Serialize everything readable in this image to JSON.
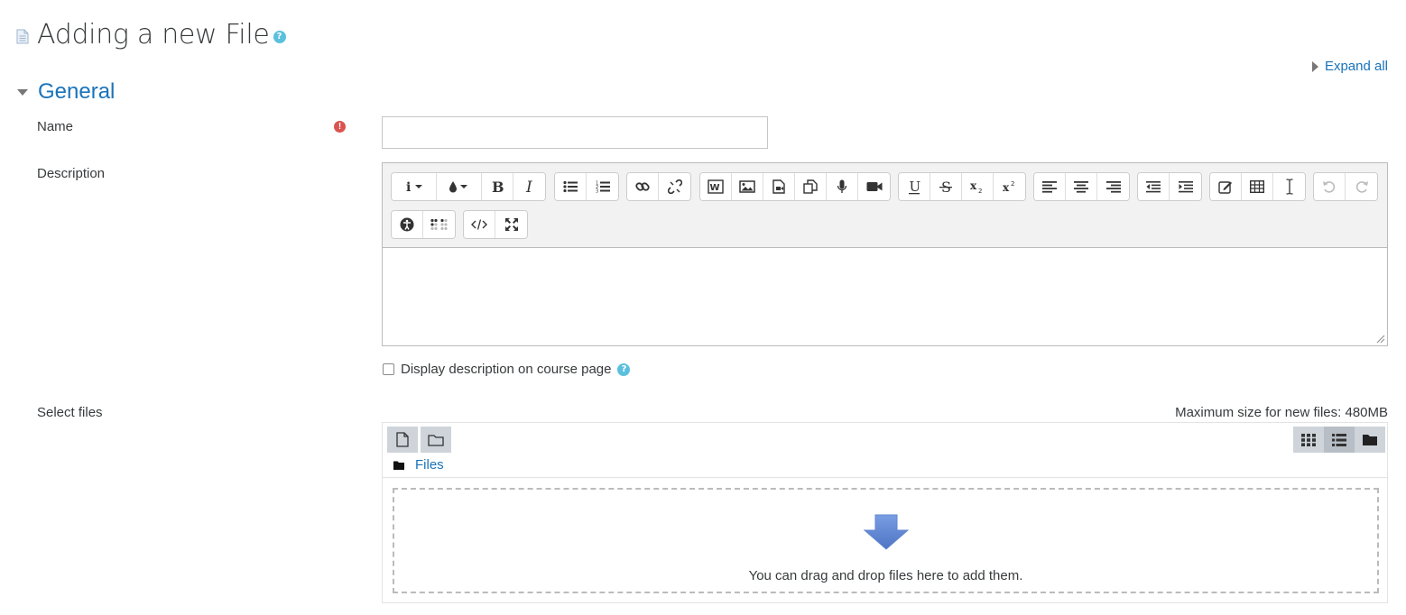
{
  "page": {
    "title": "Adding a new File",
    "expand_all": "Expand all"
  },
  "section": {
    "title": "General"
  },
  "form": {
    "name_label": "Name",
    "name_value": "",
    "description_label": "Description",
    "display_description_label": "Display description on course page",
    "display_description_checked": false,
    "select_files_label": "Select files",
    "max_size_text": "Maximum size for new files: 480MB"
  },
  "editor": {
    "toolbar_groups": [
      [
        "paragraph-style",
        "font-color",
        "bold",
        "italic"
      ],
      [
        "unordered-list",
        "ordered-list"
      ],
      [
        "link",
        "unlink"
      ],
      [
        "word-import",
        "image",
        "media",
        "manage-files",
        "record-audio",
        "record-video"
      ],
      [
        "underline",
        "strikethrough",
        "subscript",
        "superscript"
      ],
      [
        "align-left",
        "align-center",
        "align-right"
      ],
      [
        "outdent",
        "indent"
      ],
      [
        "equation",
        "table",
        "clear-formatting"
      ],
      [
        "undo",
        "redo"
      ],
      [
        "accessibility-checker",
        "screen-reader-helper"
      ],
      [
        "html-source",
        "fullscreen"
      ]
    ],
    "content": ""
  },
  "filemanager": {
    "path_folder": "Files",
    "drop_text": "You can drag and drop files here to add them.",
    "view_modes": [
      "icons",
      "details",
      "tree"
    ],
    "active_view": "details"
  },
  "colors": {
    "link": "#1a73ba",
    "help": "#5bc0de",
    "required": "#d9534f",
    "drop_arrow": "#5f86d1"
  }
}
